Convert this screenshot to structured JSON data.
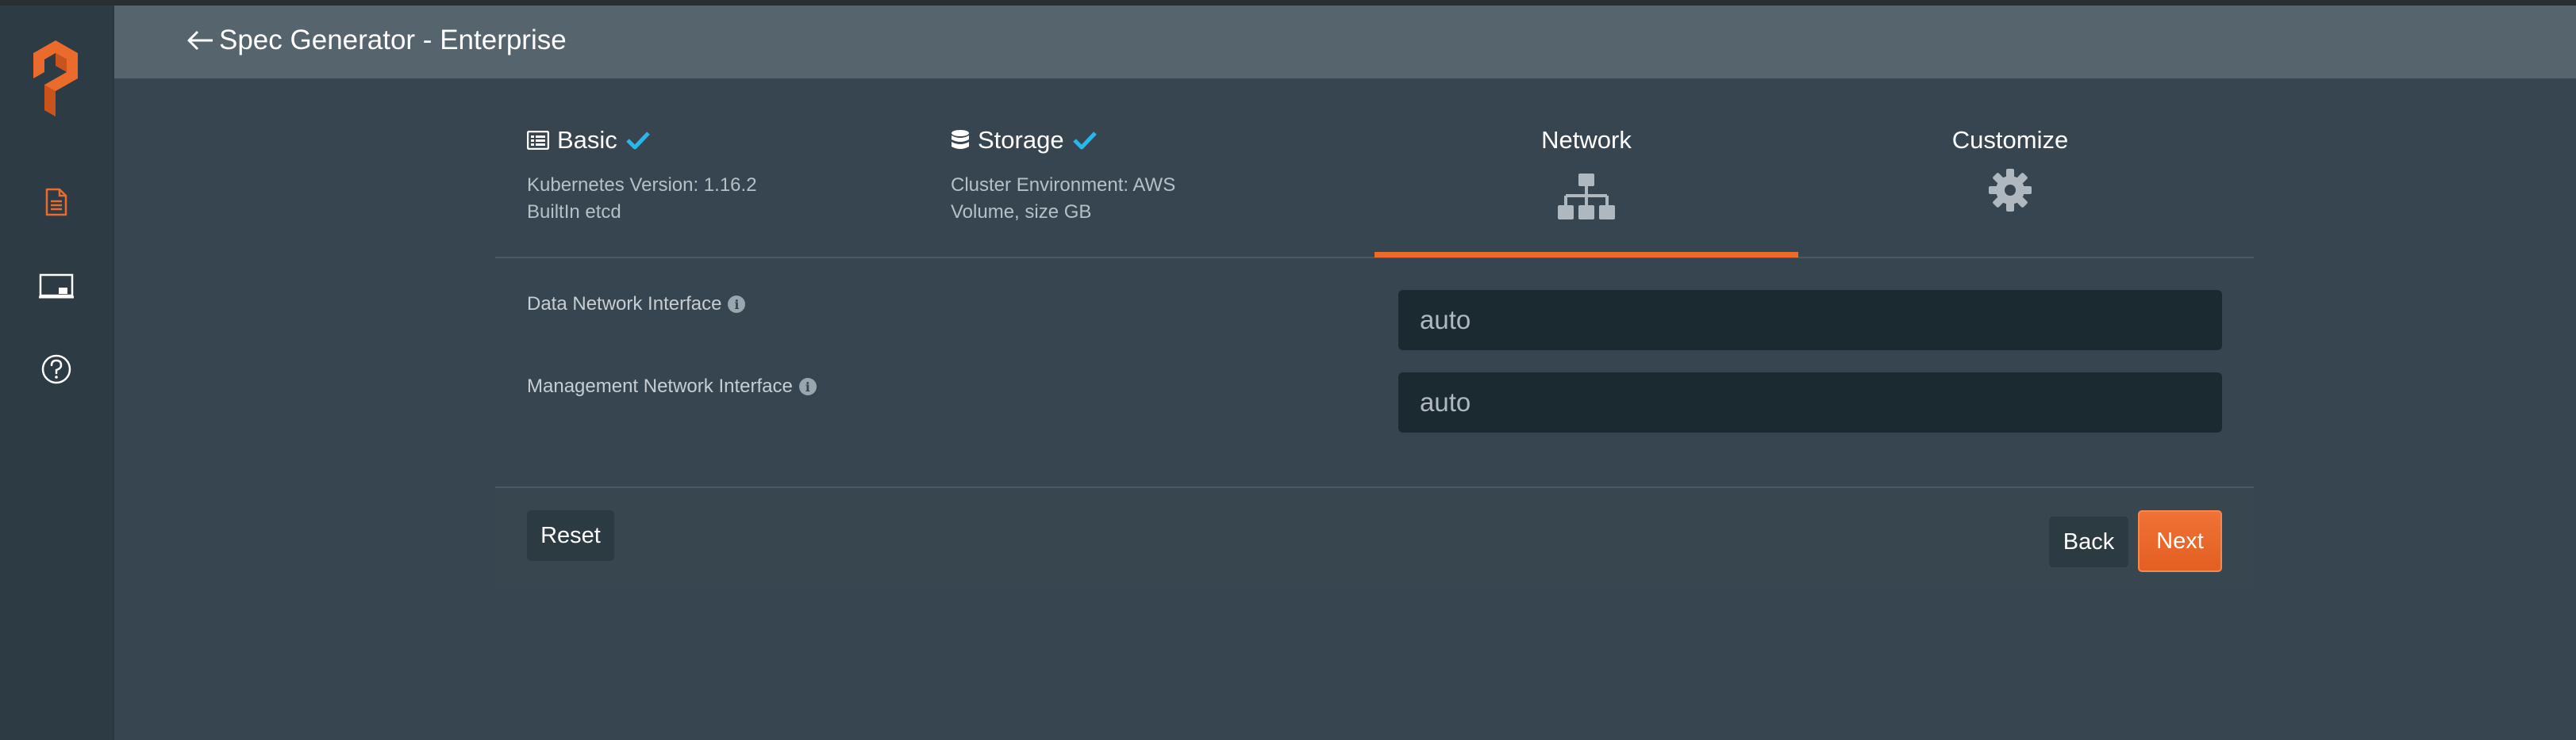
{
  "app": {
    "title": "Spec Generator - Enterprise",
    "back_icon": "arrow-left-icon",
    "verified_icon": "verified-badge-icon"
  },
  "sidebar": {
    "logo": "portworx-logo",
    "items": [
      {
        "icon": "document-icon",
        "active": true
      },
      {
        "icon": "dashboard-icon",
        "active": false
      },
      {
        "icon": "help-icon",
        "active": false
      }
    ]
  },
  "steps": [
    {
      "title": "Basic",
      "icon": "list-icon",
      "completed": true,
      "lines": [
        "Kubernetes Version: 1.16.2",
        "BuiltIn etcd"
      ]
    },
    {
      "title": "Storage",
      "icon": "database-icon",
      "completed": true,
      "lines": [
        "Cluster Environment: AWS",
        "Volume, size GB"
      ]
    },
    {
      "title": "Network",
      "icon": "sitemap-icon",
      "active": true
    },
    {
      "title": "Customize",
      "icon": "gear-icon"
    }
  ],
  "form": {
    "data_interface": {
      "label": "Data Network Interface",
      "value": "auto"
    },
    "management_interface": {
      "label": "Management Network Interface",
      "value": "auto"
    }
  },
  "buttons": {
    "reset": "Reset",
    "back": "Back",
    "next": "Next"
  },
  "colors": {
    "accent": "#ea6b2c",
    "check": "#29b6e8",
    "background": "#36454f",
    "header": "#55646d",
    "sidebar": "#2c3b44",
    "input": "#1b2a31"
  }
}
